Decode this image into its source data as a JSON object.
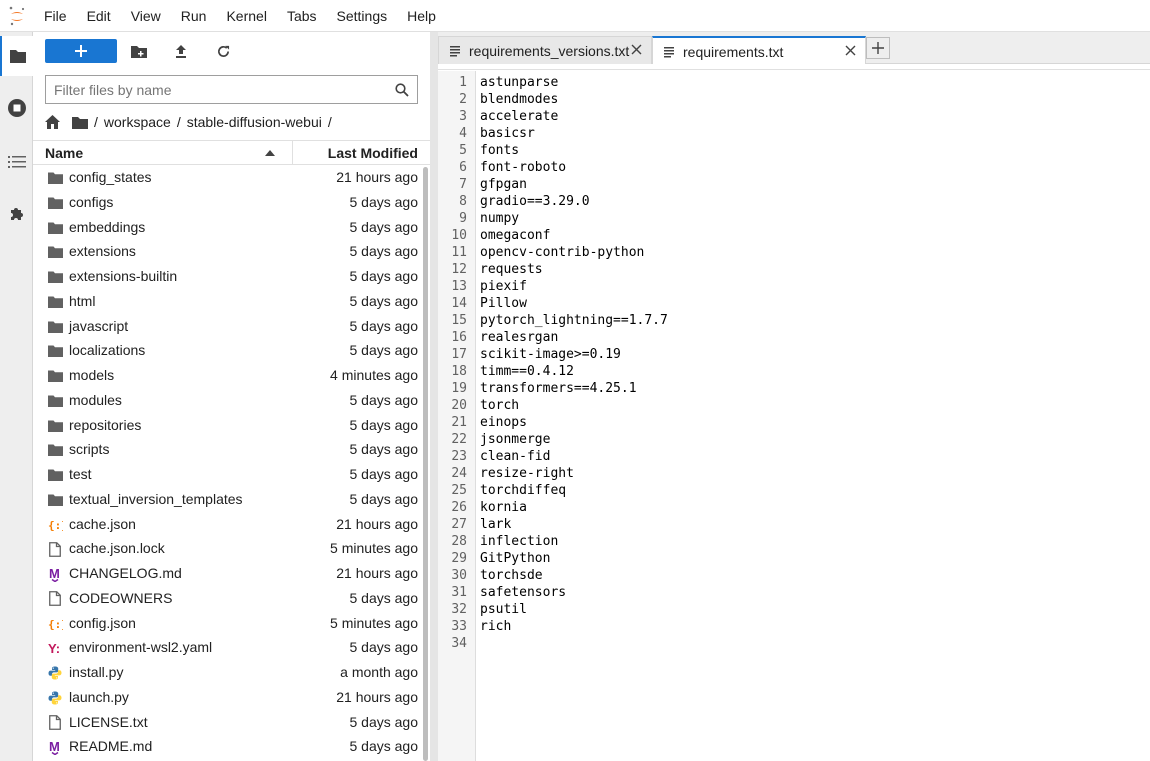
{
  "menu": [
    "File",
    "Edit",
    "View",
    "Run",
    "Kernel",
    "Tabs",
    "Settings",
    "Help"
  ],
  "colors": {
    "accent": "#1976d2",
    "folder": "#616161",
    "json": "#f57c00",
    "markdown": "#7b1fa2",
    "yaml": "#c2185b",
    "python_blue": "#3776ab",
    "python_yellow": "#ffd43b"
  },
  "filebrowser": {
    "filter_placeholder": "Filter files by name",
    "breadcrumb_sep": "/",
    "breadcrumbs": [
      "workspace",
      "stable-diffusion-webui"
    ],
    "header_name": "Name",
    "header_modified": "Last Modified",
    "files": [
      {
        "name": "config_states",
        "modified": "21 hours ago",
        "type": "folder"
      },
      {
        "name": "configs",
        "modified": "5 days ago",
        "type": "folder"
      },
      {
        "name": "embeddings",
        "modified": "5 days ago",
        "type": "folder"
      },
      {
        "name": "extensions",
        "modified": "5 days ago",
        "type": "folder"
      },
      {
        "name": "extensions-builtin",
        "modified": "5 days ago",
        "type": "folder"
      },
      {
        "name": "html",
        "modified": "5 days ago",
        "type": "folder"
      },
      {
        "name": "javascript",
        "modified": "5 days ago",
        "type": "folder"
      },
      {
        "name": "localizations",
        "modified": "5 days ago",
        "type": "folder"
      },
      {
        "name": "models",
        "modified": "4 minutes ago",
        "type": "folder"
      },
      {
        "name": "modules",
        "modified": "5 days ago",
        "type": "folder"
      },
      {
        "name": "repositories",
        "modified": "5 days ago",
        "type": "folder"
      },
      {
        "name": "scripts",
        "modified": "5 days ago",
        "type": "folder"
      },
      {
        "name": "test",
        "modified": "5 days ago",
        "type": "folder"
      },
      {
        "name": "textual_inversion_templates",
        "modified": "5 days ago",
        "type": "folder"
      },
      {
        "name": "cache.json",
        "modified": "21 hours ago",
        "type": "json"
      },
      {
        "name": "cache.json.lock",
        "modified": "5 minutes ago",
        "type": "file"
      },
      {
        "name": "CHANGELOG.md",
        "modified": "21 hours ago",
        "type": "markdown"
      },
      {
        "name": "CODEOWNERS",
        "modified": "5 days ago",
        "type": "file"
      },
      {
        "name": "config.json",
        "modified": "5 minutes ago",
        "type": "json"
      },
      {
        "name": "environment-wsl2.yaml",
        "modified": "5 days ago",
        "type": "yaml"
      },
      {
        "name": "install.py",
        "modified": "a month ago",
        "type": "python"
      },
      {
        "name": "launch.py",
        "modified": "21 hours ago",
        "type": "python"
      },
      {
        "name": "LICENSE.txt",
        "modified": "5 days ago",
        "type": "file"
      },
      {
        "name": "README.md",
        "modified": "5 days ago",
        "type": "markdown"
      }
    ]
  },
  "tabs": [
    {
      "label": "requirements_versions.txt",
      "active": false
    },
    {
      "label": "requirements.txt",
      "active": true
    }
  ],
  "editor": {
    "lines": [
      "astunparse",
      "blendmodes",
      "accelerate",
      "basicsr",
      "fonts",
      "font-roboto",
      "gfpgan",
      "gradio==3.29.0",
      "numpy",
      "omegaconf",
      "opencv-contrib-python",
      "requests",
      "piexif",
      "Pillow",
      "pytorch_lightning==1.7.7",
      "realesrgan",
      "scikit-image>=0.19",
      "timm==0.4.12",
      "transformers==4.25.1",
      "torch",
      "einops",
      "jsonmerge",
      "clean-fid",
      "resize-right",
      "torchdiffeq",
      "kornia",
      "lark",
      "inflection",
      "GitPython",
      "torchsde",
      "safetensors",
      "psutil",
      "rich",
      ""
    ]
  }
}
